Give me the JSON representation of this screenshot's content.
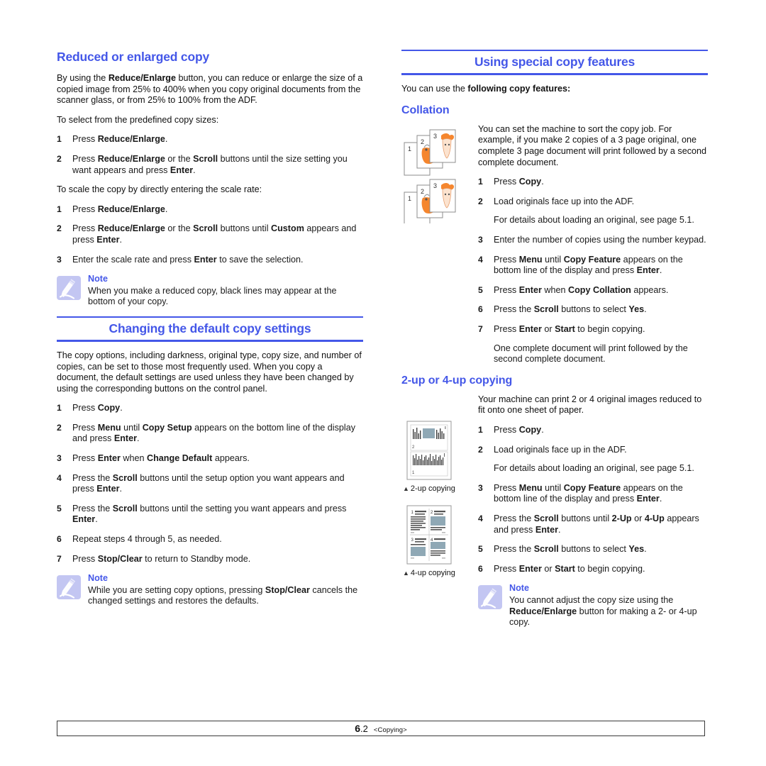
{
  "document": {
    "footer": {
      "page_major": "6",
      "page_minor": ".2",
      "chapter": "<Copying>"
    },
    "colors": {
      "heading_blue": "#4457E8",
      "note_icon_bg": "#C3C6F2",
      "illustration_orange": "#F5862E"
    }
  },
  "left_column": {
    "section1": {
      "heading": "Reduced or enlarged copy",
      "intro_1_parts": [
        "By using the ",
        "Reduce/Enlarge",
        " button, you can reduce or enlarge the size of a copied image from 25% to 400% when you copy original documents from the scanner glass, or from 25% to 100% from the ADF."
      ],
      "lead_1": "To select from the predefined copy sizes:",
      "steps_a": [
        {
          "num": "1",
          "parts": [
            "Press ",
            "Reduce/Enlarge",
            "."
          ]
        },
        {
          "num": "2",
          "parts": [
            "Press ",
            "Reduce/Enlarge",
            " or the ",
            "Scroll",
            " buttons until the size setting you want appears and press ",
            "Enter",
            "."
          ]
        }
      ],
      "lead_2": "To scale the copy by directly entering the scale rate:",
      "steps_b": [
        {
          "num": "1",
          "parts": [
            "Press ",
            "Reduce/Enlarge",
            "."
          ]
        },
        {
          "num": "2",
          "parts": [
            "Press ",
            "Reduce/Enlarge",
            " or the ",
            "Scroll",
            " buttons until ",
            "Custom",
            " appears and press ",
            "Enter",
            "."
          ]
        },
        {
          "num": "3",
          "parts": [
            "Enter the scale rate and press ",
            "Enter",
            " to save the selection."
          ]
        }
      ],
      "note": {
        "title": "Note",
        "text": "When you make a reduced copy, black lines may appear at the bottom of your copy."
      }
    },
    "section2": {
      "heading": "Changing the default copy settings",
      "intro": "The copy options, including darkness, original type, copy size, and number of copies, can be set to those most frequently used. When you copy a document, the default settings are used unless they have been changed by using the corresponding buttons on the control panel.",
      "steps": [
        {
          "num": "1",
          "parts": [
            "Press ",
            "Copy",
            "."
          ]
        },
        {
          "num": "2",
          "parts": [
            "Press ",
            "Menu",
            " until ",
            "Copy Setup",
            " appears on the bottom line of the display and press ",
            "Enter",
            "."
          ]
        },
        {
          "num": "3",
          "parts": [
            "Press ",
            "Enter",
            " when ",
            "Change Default",
            " appears."
          ]
        },
        {
          "num": "4",
          "parts": [
            "Press the ",
            "Scroll",
            " buttons until the setup option you want appears and press ",
            "Enter",
            "."
          ]
        },
        {
          "num": "5",
          "parts": [
            "Press the ",
            "Scroll",
            " buttons until the setting you want appears and press ",
            "Enter",
            "."
          ]
        },
        {
          "num": "6",
          "parts": [
            "Repeat steps 4 through 5, as needed."
          ]
        },
        {
          "num": "7",
          "parts": [
            "Press ",
            "Stop/Clear",
            " to return to Standby mode."
          ]
        }
      ],
      "note": {
        "title": "Note",
        "text_parts": [
          "While you are setting copy options, pressing ",
          "Stop/Clear",
          " cancels the changed settings and restores the defaults."
        ]
      }
    }
  },
  "right_column": {
    "heading": "Using special copy features",
    "intro_parts": [
      "You can use the ",
      "following copy features:"
    ],
    "collation": {
      "heading": "Collation",
      "figure": {
        "name": "collation-illustration",
        "stacks": 2,
        "page_labels": [
          "1",
          "2",
          "3"
        ]
      },
      "intro": "You can set the machine to sort the copy job. For example, if you make 2 copies of a 3 page original, one complete 3 page document will print followed by a second complete document.",
      "steps": [
        {
          "num": "1",
          "parts": [
            "Press ",
            "Copy",
            "."
          ]
        },
        {
          "num": "2",
          "parts": [
            "Load originals face up into the ADF."
          ],
          "cont": "For details about loading an original, see page 5.1."
        },
        {
          "num": "3",
          "parts": [
            "Enter the number of copies using the number keypad."
          ]
        },
        {
          "num": "4",
          "parts": [
            "Press ",
            "Menu",
            " until ",
            "Copy Feature",
            " appears on the bottom line of the display and press ",
            "Enter",
            "."
          ]
        },
        {
          "num": "5",
          "parts": [
            "Press ",
            "Enter",
            " when ",
            "Copy Collation",
            " appears."
          ]
        },
        {
          "num": "6",
          "parts": [
            "Press the ",
            "Scroll",
            " buttons to select ",
            "Yes",
            "."
          ]
        },
        {
          "num": "7",
          "parts": [
            "Press ",
            "Enter",
            " or ",
            "Start",
            " to begin copying."
          ],
          "cont": "One complete document will print followed by the second complete document."
        }
      ]
    },
    "nup": {
      "heading": "2-up or 4-up copying",
      "figure_2up_caption": "2-up copying",
      "figure_4up_caption": "4-up copying",
      "figure_4up_labels": [
        "1",
        "2",
        "3",
        "4"
      ],
      "intro": "Your machine can print 2 or 4 original images reduced to fit onto one sheet of paper.",
      "steps": [
        {
          "num": "1",
          "parts": [
            "Press ",
            "Copy",
            "."
          ]
        },
        {
          "num": "2",
          "parts": [
            "Load originals face up in the ADF."
          ],
          "cont": "For details about loading an original, see page 5.1."
        },
        {
          "num": "3",
          "parts": [
            "Press ",
            "Menu",
            " until ",
            "Copy Feature",
            " appears on the bottom line of the display and press ",
            "Enter",
            "."
          ]
        },
        {
          "num": "4",
          "parts": [
            "Press the ",
            "Scroll",
            " buttons until ",
            "2-Up",
            " or ",
            "4-Up",
            " appears and press ",
            "Enter",
            "."
          ]
        },
        {
          "num": "5",
          "parts": [
            "Press the ",
            "Scroll",
            " buttons to select ",
            "Yes",
            "."
          ]
        },
        {
          "num": "6",
          "parts": [
            "Press ",
            "Enter",
            " or ",
            "Start",
            " to begin copying."
          ]
        }
      ],
      "note": {
        "title": "Note",
        "text_parts": [
          "You cannot adjust the copy size using the ",
          "Reduce/Enlarge",
          " button for making a 2- or 4-up copy."
        ]
      }
    }
  }
}
